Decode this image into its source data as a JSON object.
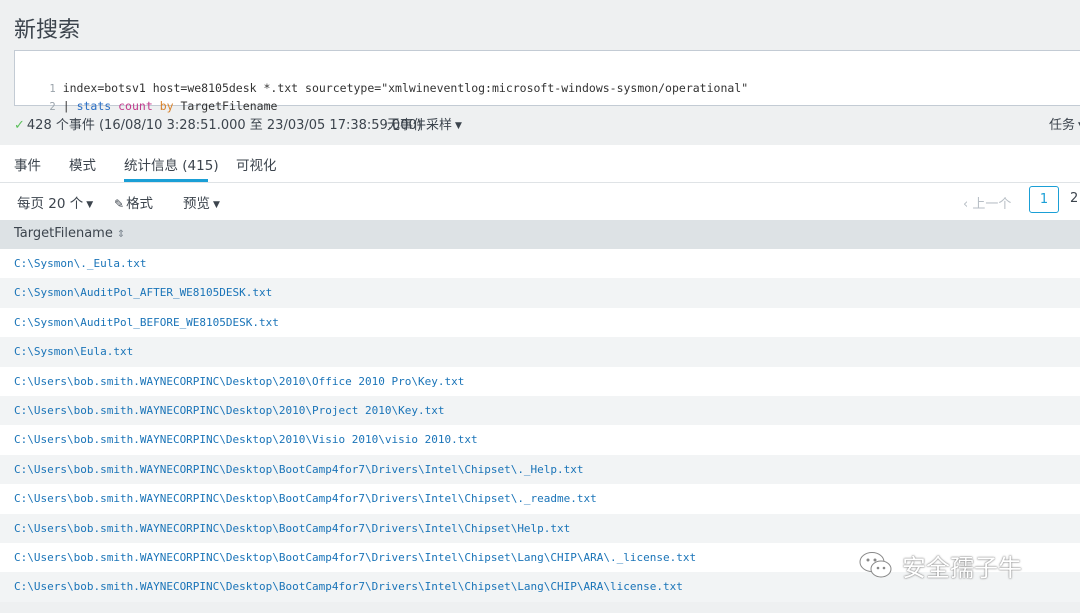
{
  "page_title": "新搜索",
  "editor": {
    "line1_num": "1",
    "line1_text": "index=botsv1 host=we8105desk *.txt sourcetype=\"xmlwineventlog:microsoft-windows-sysmon/operational\"",
    "line2_num": "2",
    "line2_pipe": "| ",
    "line2_cmd": "stats",
    "line2_fn": "count",
    "line2_by": "by",
    "line2_field": "TargetFilename"
  },
  "status": {
    "check": "✓",
    "summary": "428 个事件 (16/08/10 3:28:51.000 至 23/03/05 17:38:59.000)",
    "sampling": "无事件采样",
    "tasks": "任务"
  },
  "tabs": [
    "事件",
    "模式",
    "统计信息 (415)",
    "可视化"
  ],
  "toolbar": {
    "per_page": "每页 20 个",
    "format": "格式",
    "preview": "预览",
    "prev": "‹ 上一个",
    "page1": "1",
    "page2": "2"
  },
  "table": {
    "header": "TargetFilename",
    "rows": [
      "C:\\Sysmon\\._Eula.txt",
      "C:\\Sysmon\\AuditPol_AFTER_WE8105DESK.txt",
      "C:\\Sysmon\\AuditPol_BEFORE_WE8105DESK.txt",
      "C:\\Sysmon\\Eula.txt",
      "C:\\Users\\bob.smith.WAYNECORPINC\\Desktop\\2010\\Office 2010 Pro\\Key.txt",
      "C:\\Users\\bob.smith.WAYNECORPINC\\Desktop\\2010\\Project 2010\\Key.txt",
      "C:\\Users\\bob.smith.WAYNECORPINC\\Desktop\\2010\\Visio 2010\\visio 2010.txt",
      "C:\\Users\\bob.smith.WAYNECORPINC\\Desktop\\BootCamp4for7\\Drivers\\Intel\\Chipset\\._Help.txt",
      "C:\\Users\\bob.smith.WAYNECORPINC\\Desktop\\BootCamp4for7\\Drivers\\Intel\\Chipset\\._readme.txt",
      "C:\\Users\\bob.smith.WAYNECORPINC\\Desktop\\BootCamp4for7\\Drivers\\Intel\\Chipset\\Help.txt",
      "C:\\Users\\bob.smith.WAYNECORPINC\\Desktop\\BootCamp4for7\\Drivers\\Intel\\Chipset\\Lang\\CHIP\\ARA\\._license.txt",
      "C:\\Users\\bob.smith.WAYNECORPINC\\Desktop\\BootCamp4for7\\Drivers\\Intel\\Chipset\\Lang\\CHIP\\ARA\\license.txt"
    ]
  },
  "watermark": "安全孺子牛",
  "colors": {
    "accent": "#1a9fd6",
    "link": "#1a74b8",
    "success": "#5cc05c"
  }
}
